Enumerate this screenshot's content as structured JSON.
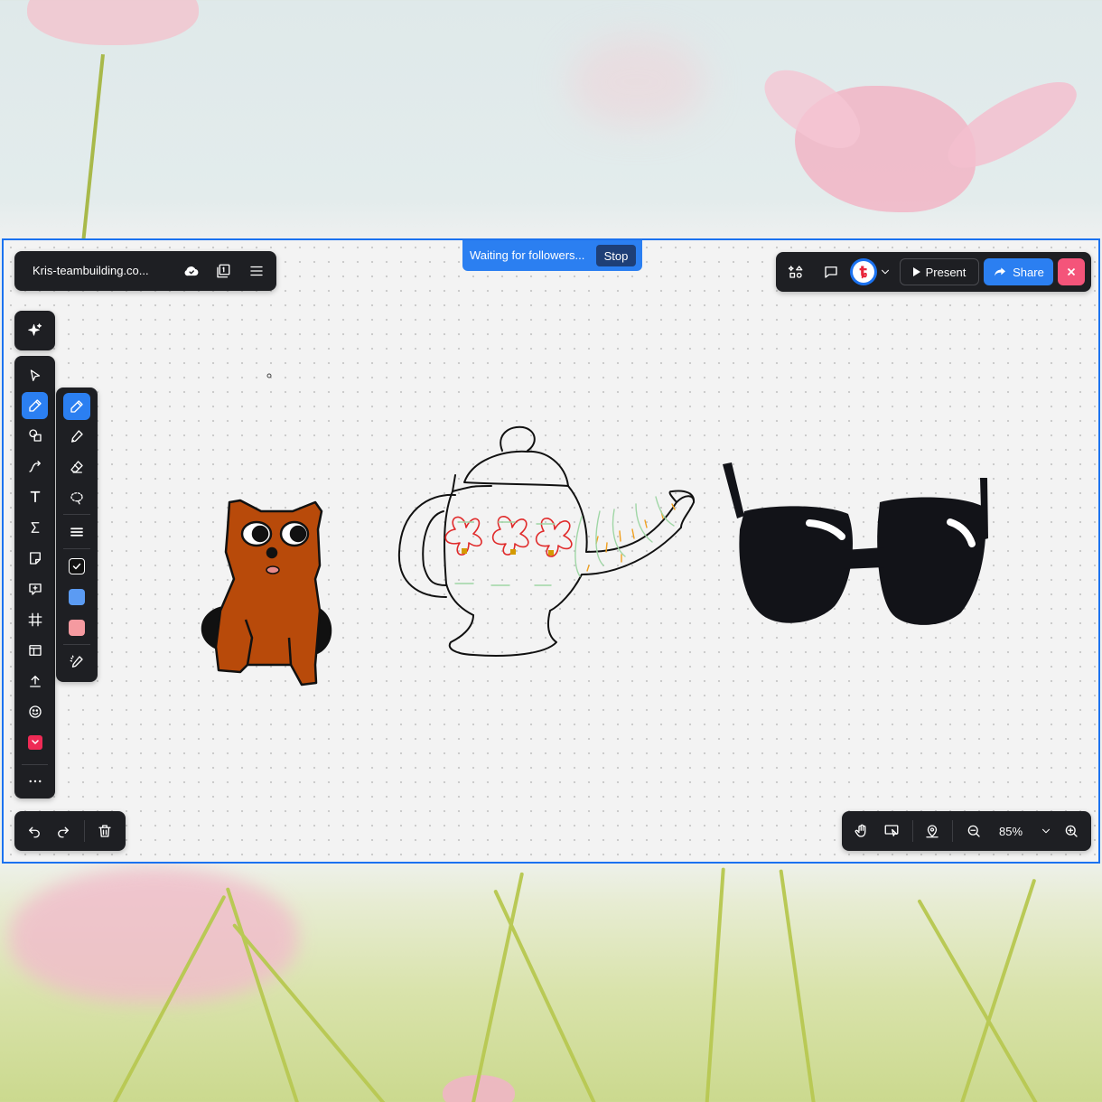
{
  "header": {
    "board_title": "Kris-teambuilding.co...",
    "follow_banner_text": "Waiting for followers...",
    "stop_label": "Stop"
  },
  "topbar": {
    "present_label": "Present",
    "share_label": "Share"
  },
  "pen_panel": {
    "color_swatches": [
      "#5b9bf3",
      "#f59aa0"
    ]
  },
  "zoom": {
    "level": "85%"
  },
  "colors": {
    "accent": "#2b7ff1",
    "close": "#f4547a",
    "toolbar": "#1e1f23"
  }
}
